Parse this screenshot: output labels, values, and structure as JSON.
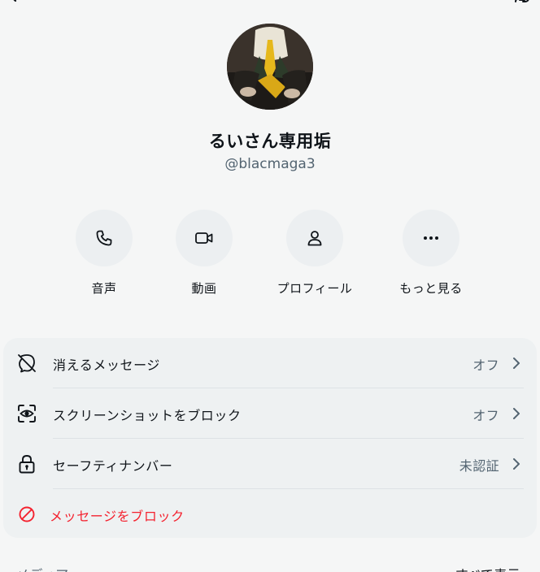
{
  "header": {
    "back_icon": "arrow-left-icon",
    "link_icon": "link-icon"
  },
  "profile": {
    "display_name": "るいさん専用垢",
    "handle": "@blacmaga3"
  },
  "actions": [
    {
      "label": "音声",
      "icon": "phone-icon"
    },
    {
      "label": "動画",
      "icon": "video-icon"
    },
    {
      "label": "プロフィール",
      "icon": "person-icon"
    },
    {
      "label": "もっと見る",
      "icon": "more-icon"
    }
  ],
  "settings": [
    {
      "label": "消えるメッセージ",
      "value": "オフ",
      "icon": "disappearing-message-icon"
    },
    {
      "label": "スクリーンショットをブロック",
      "value": "オフ",
      "icon": "screenshot-block-icon"
    },
    {
      "label": "セーフティナンバー",
      "value": "未認証",
      "icon": "lock-icon"
    },
    {
      "label": "メッセージをブロック",
      "icon": "block-icon",
      "color": "#f4212e"
    }
  ],
  "media": {
    "title": "メディア",
    "show_all": "すべて表示"
  },
  "colors": {
    "background": "#f5f6f6",
    "card": "#eef1f2",
    "danger": "#f4212e",
    "secondary_text": "#536471"
  }
}
